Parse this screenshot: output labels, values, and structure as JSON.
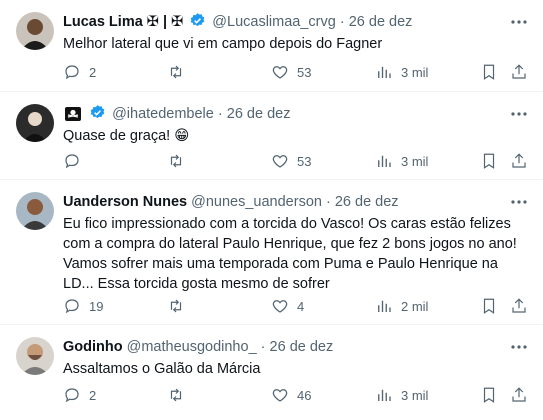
{
  "tweets": [
    {
      "name": "Lucas Lima ✠ | ✠",
      "handle": "@Lucaslimaa_crvg",
      "dot": "·",
      "date": "26 de dez",
      "text": "Melhor lateral que vi em campo depois do Fagner",
      "replies": "2",
      "retweets": "",
      "likes": "53",
      "views": "3 mil"
    },
    {
      "name": "",
      "handle": "@ihatedembele",
      "dot": "·",
      "date": "26 de dez",
      "text": "Quase de graça! 😁",
      "replies": "",
      "retweets": "",
      "likes": "53",
      "views": "3 mil"
    },
    {
      "name": "Uanderson Nunes",
      "handle": "@nunes_uanderson",
      "dot": "·",
      "date": "26 de dez",
      "text": "Eu fico impressionado com a torcida do Vasco! Os caras estão felizes com a compra do lateral Paulo Henrique, que fez 2 bons jogos no ano! Vamos sofrer mais uma temporada com Puma e Paulo Henrique na LD... Essa torcida gosta mesmo de sofrer",
      "replies": "19",
      "retweets": "",
      "likes": "4",
      "views": "2 mil"
    },
    {
      "name": "Godinho",
      "handle": "@matheusgodinho_",
      "dot": "·",
      "date": "26 de dez",
      "text": "Assaltamos o Galão da Márcia",
      "replies": "2",
      "retweets": "",
      "likes": "46",
      "views": "3 mil"
    }
  ],
  "colors": {
    "text": "#0f1419",
    "secondary": "#536471",
    "verified": "#1d9bf0",
    "divider": "#eff3f4"
  },
  "icons": [
    "more-icon",
    "reply-icon",
    "retweet-icon",
    "like-icon",
    "views-icon",
    "bookmark-icon",
    "share-icon",
    "verified-badge-icon",
    "pirate-flag-icon"
  ]
}
